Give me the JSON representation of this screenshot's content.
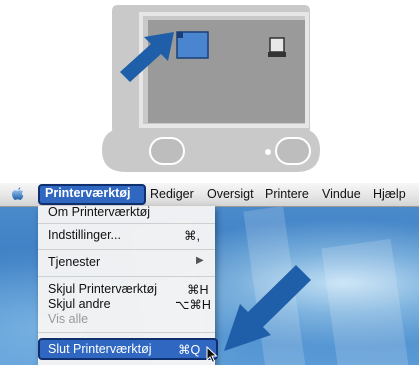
{
  "illustration": {
    "monitor_colors": {
      "bezel": "#c9c9c9",
      "screen": "#9a9a9a",
      "window": "#4a86cf",
      "arrow": "#1f5ea8"
    }
  },
  "menubar": {
    "app_menu": "Printerværktøj",
    "items": [
      "Rediger",
      "Oversigt",
      "Printere",
      "Vindue",
      "Hjælp"
    ]
  },
  "dropdown": {
    "items": [
      {
        "label": "Om Printerværktøj",
        "shortcut": ""
      },
      {
        "label": "Indstillinger...",
        "shortcut": "⌘,"
      },
      {
        "label": "Tjenester",
        "shortcut": "▶"
      },
      {
        "label": "Skjul Printerværktøj",
        "shortcut": "⌘H"
      },
      {
        "label": "Skjul andre",
        "shortcut": "⌥⌘H"
      },
      {
        "label": "Vis alle",
        "shortcut": ""
      },
      {
        "label": "Slut Printerværktøj",
        "shortcut": "⌘Q"
      }
    ]
  },
  "colors": {
    "highlight": "#2f67c1",
    "highlight_border": "#0f2f6e",
    "arrow": "#1f5ea8"
  }
}
